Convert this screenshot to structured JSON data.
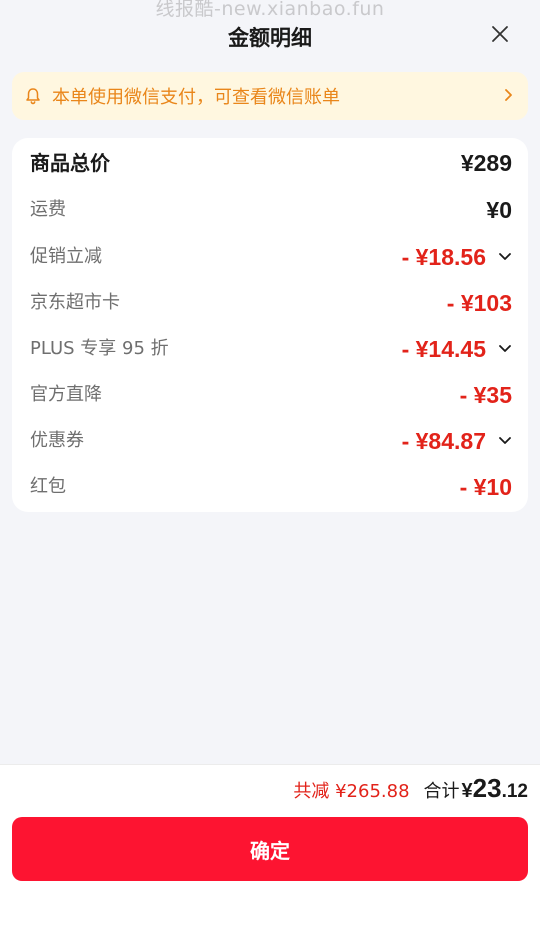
{
  "watermark": "线报酷-new.xianbao.fun",
  "header": {
    "title": "金额明细"
  },
  "notice": {
    "text": "本单使用微信支付，可查看微信账单"
  },
  "details": {
    "total_goods": {
      "label": "商品总价",
      "amount": "¥289"
    },
    "rows": [
      {
        "label": "运费",
        "amount": "¥0",
        "color": "#1a1a1a",
        "expandable": false
      },
      {
        "label": "促销立减",
        "amount": "- ¥18.56",
        "color": "#e2231a",
        "expandable": true
      },
      {
        "label": "京东超市卡",
        "amount": "- ¥103",
        "color": "#e2231a",
        "expandable": false
      },
      {
        "label": "PLUS 专享 95 折",
        "amount": "- ¥14.45",
        "color": "#e2231a",
        "expandable": true
      },
      {
        "label": "官方直降",
        "amount": "- ¥35",
        "color": "#e2231a",
        "expandable": false
      },
      {
        "label": "优惠券",
        "amount": "- ¥84.87",
        "color": "#e2231a",
        "expandable": true
      },
      {
        "label": "红包",
        "amount": "- ¥10",
        "color": "#e2231a",
        "expandable": false
      }
    ]
  },
  "footer": {
    "saved_text": "共减 ¥265.88",
    "total_label": "合计",
    "total_currency": "¥",
    "total_integer": "23",
    "total_decimal": ".12",
    "confirm_label": "确定"
  },
  "colors": {
    "accent_red": "#e2231a",
    "button_red": "#fd1431",
    "notice_bg": "#fff7e0",
    "notice_text": "#e9861a"
  },
  "icons": {
    "close": "close-icon",
    "bell": "bell-icon",
    "notice_arrow": "chevron-right-icon",
    "expand": "chevron-down-icon"
  }
}
